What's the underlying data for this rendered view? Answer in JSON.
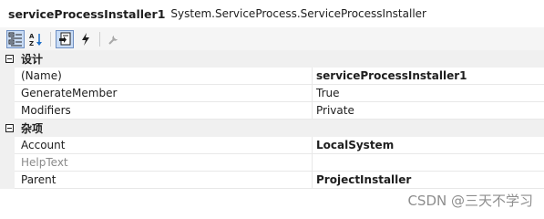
{
  "header": {
    "object_name": "serviceProcessInstaller1",
    "object_type": "System.ServiceProcess.ServiceProcessInstaller"
  },
  "toolbar": {
    "buttons": [
      {
        "icon": "categorized-icon",
        "active": true
      },
      {
        "icon": "alphabetical-icon",
        "active": false
      },
      {
        "icon": "properties-icon",
        "active": true
      },
      {
        "icon": "events-icon",
        "active": false
      },
      {
        "icon": "property-pages-icon",
        "active": false
      }
    ]
  },
  "grid": {
    "categories": [
      {
        "label": "设计",
        "properties": [
          {
            "name": "(Name)",
            "value": "serviceProcessInstaller1"
          },
          {
            "name": "GenerateMember",
            "value": "True"
          },
          {
            "name": "Modifiers",
            "value": "Private"
          }
        ]
      },
      {
        "label": "杂项",
        "properties": [
          {
            "name": "Account",
            "value": "LocalSystem"
          },
          {
            "name": "HelpText",
            "value": ""
          },
          {
            "name": "Parent",
            "value": "ProjectInstaller"
          }
        ]
      }
    ]
  },
  "watermark": "CSDN @三天不学习"
}
